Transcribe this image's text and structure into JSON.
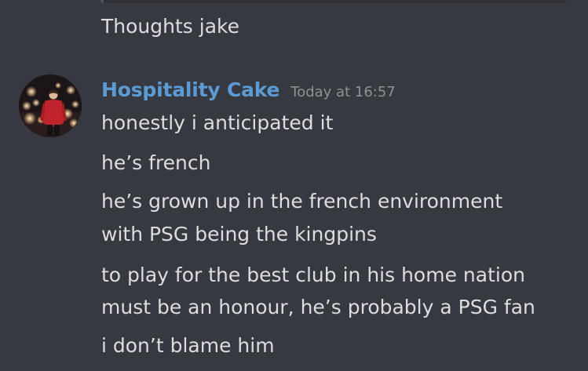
{
  "previous_message": {
    "text": "Thoughts jake"
  },
  "message": {
    "username": "Hospitality Cake",
    "timestamp": "Today at 16:57",
    "lines": [
      "honestly i anticipated it",
      "he’s french",
      "he’s grown up in the french environment",
      "with PSG being the kingpins",
      "to play for the best club in his home nation",
      "must be an honour, he’s probably a PSG fan",
      "i don’t blame him"
    ]
  },
  "colors": {
    "background": "#36393f",
    "text": "#dcddde",
    "username": "#5b9bd5",
    "timestamp": "#8e9297"
  },
  "icons": {
    "avatar": "user-avatar-photo"
  }
}
